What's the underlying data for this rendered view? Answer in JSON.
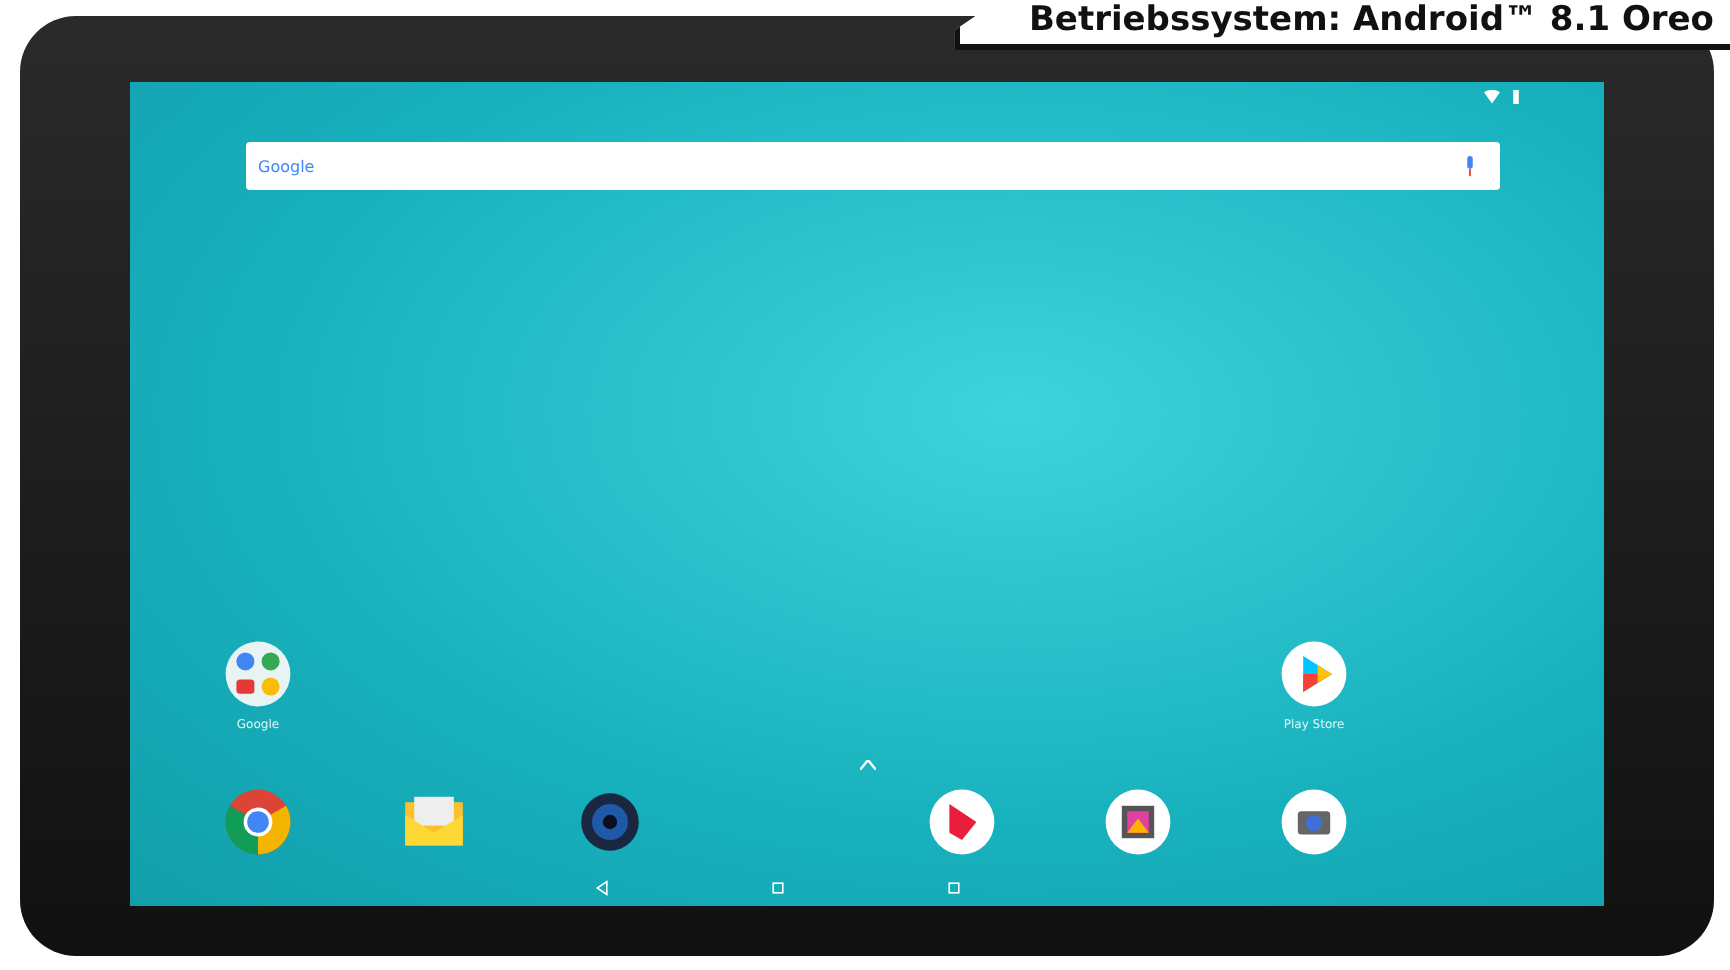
{
  "banner": {
    "text": "Betriebssystem: Android™ 8.1 Oreo"
  },
  "search": {
    "logo": "Google"
  },
  "home_apps": [
    {
      "kind": "folder",
      "label": "Google"
    },
    {
      "kind": "play-store",
      "label": "Play Store"
    }
  ],
  "dock": [
    {
      "kind": "chrome"
    },
    {
      "kind": "email"
    },
    {
      "kind": "music"
    },
    {
      "kind": "play-music"
    },
    {
      "kind": "gallery"
    },
    {
      "kind": "camera"
    }
  ]
}
